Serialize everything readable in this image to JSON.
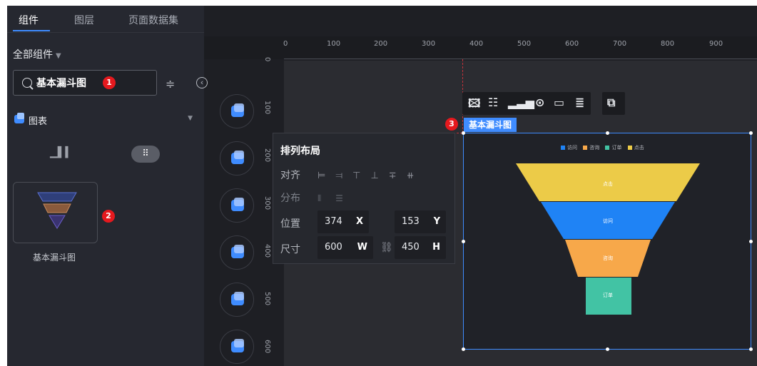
{
  "tabs": [
    {
      "label": "组件",
      "active": true
    },
    {
      "label": "图层",
      "active": false
    },
    {
      "label": "页面数据集",
      "active": false
    }
  ],
  "filter": {
    "label": "全部组件"
  },
  "search": {
    "value": "基本漏斗图"
  },
  "category": {
    "label": "图表"
  },
  "component": {
    "label": "基本漏斗图"
  },
  "callouts": [
    "1",
    "2",
    "3"
  ],
  "ruler": {
    "x_ticks": [
      "0",
      "100",
      "200",
      "300",
      "400",
      "500",
      "600",
      "700",
      "800",
      "900"
    ],
    "y_ticks": [
      "0",
      "100",
      "200",
      "300",
      "400",
      "500",
      "600"
    ]
  },
  "property_panel": {
    "title": "排列布局",
    "align_label": "对齐",
    "distribute_label": "分布",
    "position_label": "位置",
    "size_label": "尺寸",
    "x_value": "374",
    "x_unit": "X",
    "y_value": "153",
    "y_unit": "Y",
    "width_value": "600",
    "width_unit": "W",
    "height_value": "450",
    "height_unit": "H"
  },
  "selected_widget": {
    "label": "基本漏斗图"
  },
  "funnel_chart": {
    "legend": [
      {
        "name": "访问",
        "color": "#1f83f5"
      },
      {
        "name": "咨询",
        "color": "#f7a84a"
      },
      {
        "name": "订单",
        "color": "#42c3a4"
      },
      {
        "name": "点击",
        "color": "#eccb48"
      }
    ],
    "stages": [
      "点击",
      "访问",
      "咨询",
      "订单"
    ]
  },
  "colors": {
    "accent": "#3f8cff",
    "callout": "#e5191e"
  },
  "chart_data": {
    "type": "funnel",
    "categories": [
      "点击",
      "访问",
      "咨询",
      "订单"
    ],
    "legend": [
      "访问",
      "咨询",
      "订单",
      "点击"
    ]
  }
}
